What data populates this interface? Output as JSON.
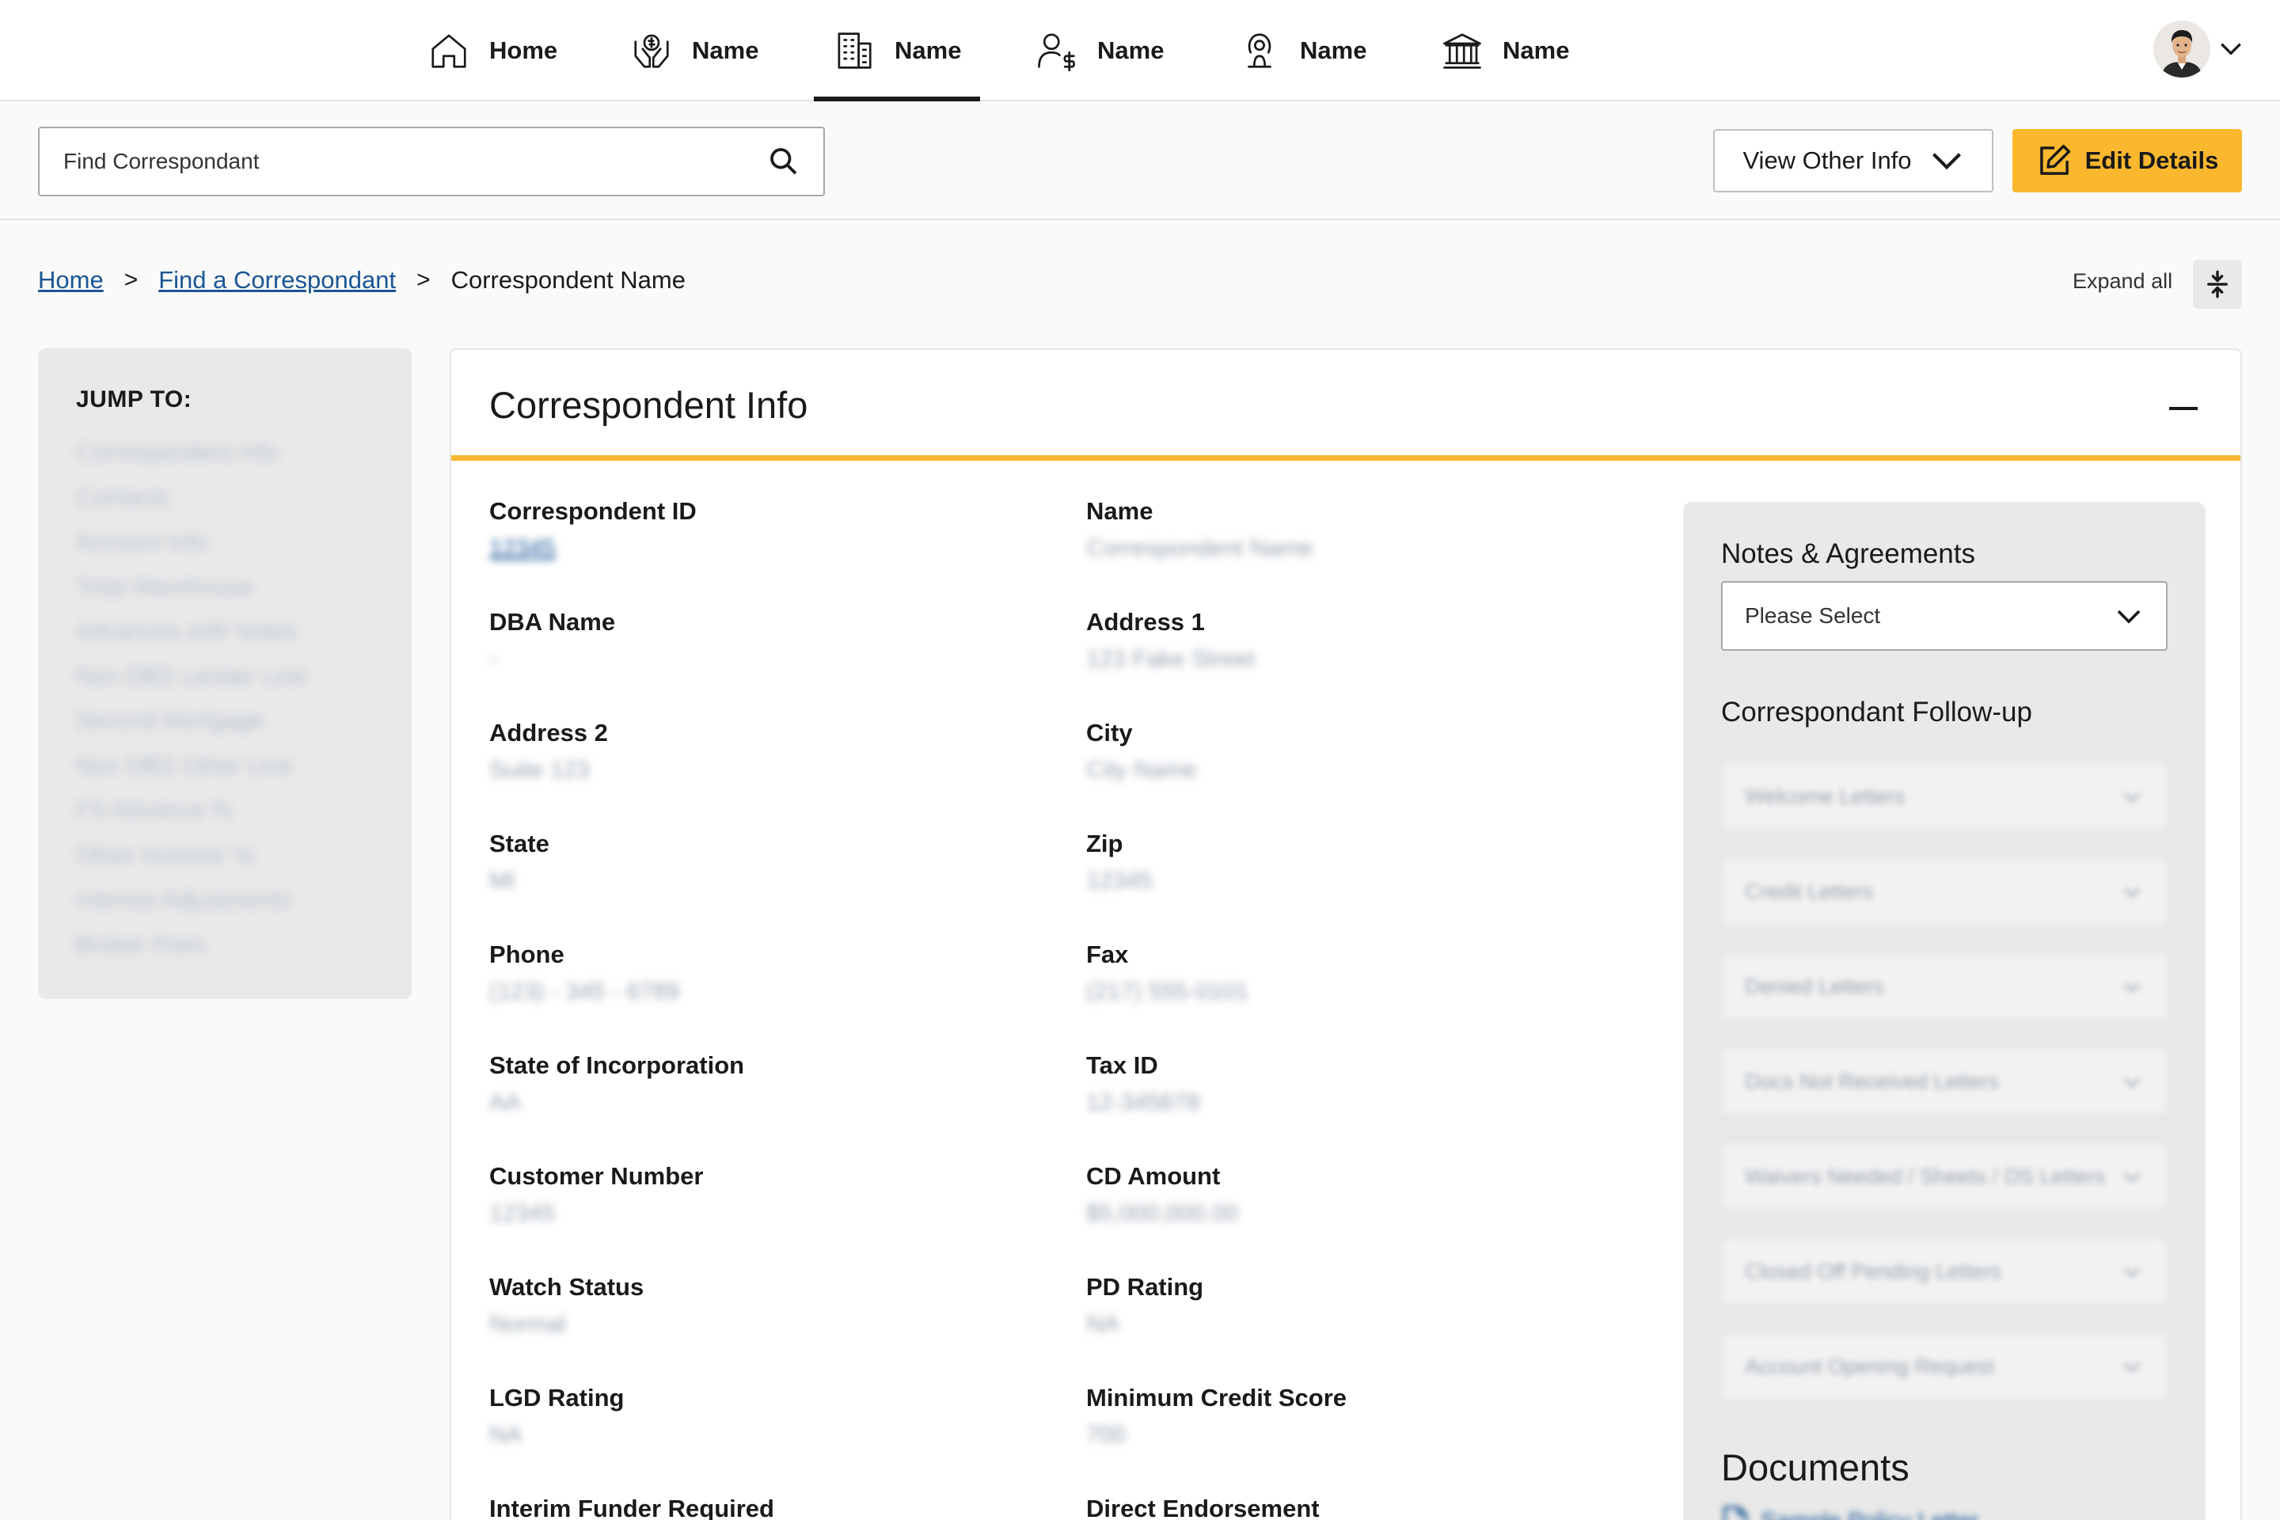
{
  "nav": {
    "items": [
      {
        "label": "Home",
        "icon": "home-icon"
      },
      {
        "label": "Name",
        "icon": "hands-dollar-icon"
      },
      {
        "label": "Name",
        "icon": "building-icon",
        "active": true
      },
      {
        "label": "Name",
        "icon": "user-dollar-icon"
      },
      {
        "label": "Name",
        "icon": "person-signal-icon"
      },
      {
        "label": "Name",
        "icon": "bank-icon"
      }
    ]
  },
  "toolbar": {
    "search_placeholder": "Find Correspondant",
    "view_other_label": "View Other Info",
    "edit_label": "Edit Details"
  },
  "breadcrumb": {
    "home": "Home",
    "find": "Find a Correspondant",
    "current": "Correspondent Name"
  },
  "expand_all_label": "Expand all",
  "jumpto": {
    "title": "JUMP TO:",
    "items": [
      "Correspondent Info",
      "Contacts",
      "Account Info",
      "Total Warehouse",
      "Advances with Notes",
      "Non DBS Lender Line",
      "Second Mortgage",
      "Non DBS Other Line",
      "FS Advance %",
      "Other Investor %",
      "Interest Adjustments",
      "Broker Fees"
    ]
  },
  "panel": {
    "title": "Correspondent Info",
    "fields_left": [
      {
        "label": "Correspondent ID",
        "value": "12345",
        "link": true
      },
      {
        "label": "DBA Name",
        "value": "-"
      },
      {
        "label": "Address 2",
        "value": "Suite 123"
      },
      {
        "label": "State",
        "value": "MI"
      },
      {
        "label": "Phone",
        "value": "(123) - 345 - 6789"
      },
      {
        "label": "State of Incorporation",
        "value": "AA"
      },
      {
        "label": "Customer Number",
        "value": "12345"
      },
      {
        "label": "Watch Status",
        "value": "Normal"
      },
      {
        "label": "LGD Rating",
        "value": "NA"
      },
      {
        "label": "Interim Funder Required",
        "value": ""
      }
    ],
    "fields_mid": [
      {
        "label": "Name",
        "value": "Correspondent Name"
      },
      {
        "label": "Address 1",
        "value": "123 Fake Street"
      },
      {
        "label": "City",
        "value": "City Name"
      },
      {
        "label": "Zip",
        "value": "12345"
      },
      {
        "label": "Fax",
        "value": "(217) 555-0101"
      },
      {
        "label": "Tax ID",
        "value": "12-345678"
      },
      {
        "label": "CD Amount",
        "value": "$5,000,000.00"
      },
      {
        "label": "PD Rating",
        "value": "NA"
      },
      {
        "label": "Minimum Credit Score",
        "value": "700"
      },
      {
        "label": "Direct Endorsement",
        "value": ""
      }
    ]
  },
  "side": {
    "notes_title": "Notes & Agreements",
    "notes_select": "Please Select",
    "followup_title": "Correspondant Follow-up",
    "followups": [
      "Welcome Letters",
      "Credit Letters",
      "Denied Letters",
      "Docs Not Received Letters",
      "Waivers Needed / Sheets / DS Letters",
      "Closed Off Pending Letters",
      "Account Opening Request"
    ],
    "documents_title": "Documents",
    "doc_link": "Sample Policy Letter"
  }
}
